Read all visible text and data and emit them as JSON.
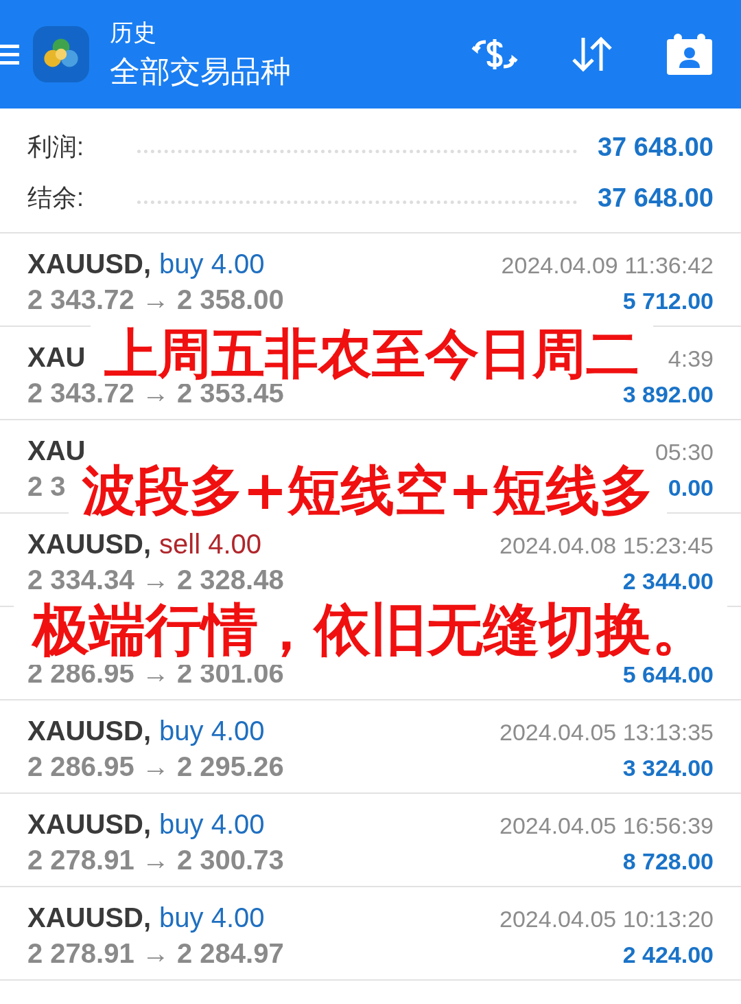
{
  "header": {
    "title": "历史",
    "subtitle": "全部交易品种"
  },
  "summary": [
    {
      "label": "利润:",
      "value": "37 648.00"
    },
    {
      "label": "结余:",
      "value": "37 648.00"
    }
  ],
  "trades": [
    {
      "symbol": "XAUUSD,",
      "kind": "buy",
      "order": "buy 4.00",
      "time": "2024.04.09 11:36:42",
      "prices": "2 343.72 → 2 358.00",
      "profit": "5 712.00"
    },
    {
      "symbol": "XAU",
      "time": "4:39",
      "prices": "2 343.72 → 2 353.45",
      "profit": "3 892.00"
    },
    {
      "symbol": "XAU",
      "time": "05:30",
      "prices": "2 3",
      "profit": "0.00"
    },
    {
      "symbol": "XAUUSD,",
      "kind": "sell",
      "order": "sell 4.00",
      "time": "2024.04.08 15:23:45",
      "prices": "2 334.34 → 2 328.48",
      "profit": "2 344.00"
    },
    {
      "prices": "2 286.95 → 2 301.06",
      "profit": "5 644.00"
    },
    {
      "symbol": "XAUUSD,",
      "kind": "buy",
      "order": "buy 4.00",
      "time": "2024.04.05 13:13:35",
      "prices": "2 286.95 → 2 295.26",
      "profit": "3 324.00"
    },
    {
      "symbol": "XAUUSD,",
      "kind": "buy",
      "order": "buy 4.00",
      "time": "2024.04.05 16:56:39",
      "prices": "2 278.91 → 2 300.73",
      "profit": "8 728.00"
    },
    {
      "symbol": "XAUUSD,",
      "kind": "buy",
      "order": "buy 4.00",
      "time": "2024.04.05 10:13:20",
      "prices": "2 278.91 → 2 284.97",
      "profit": "2 424.00"
    }
  ],
  "captions": [
    "上周五非农至今日周二",
    "波段多+短线空+短线多",
    "极端行情，依旧无缝切换。"
  ]
}
